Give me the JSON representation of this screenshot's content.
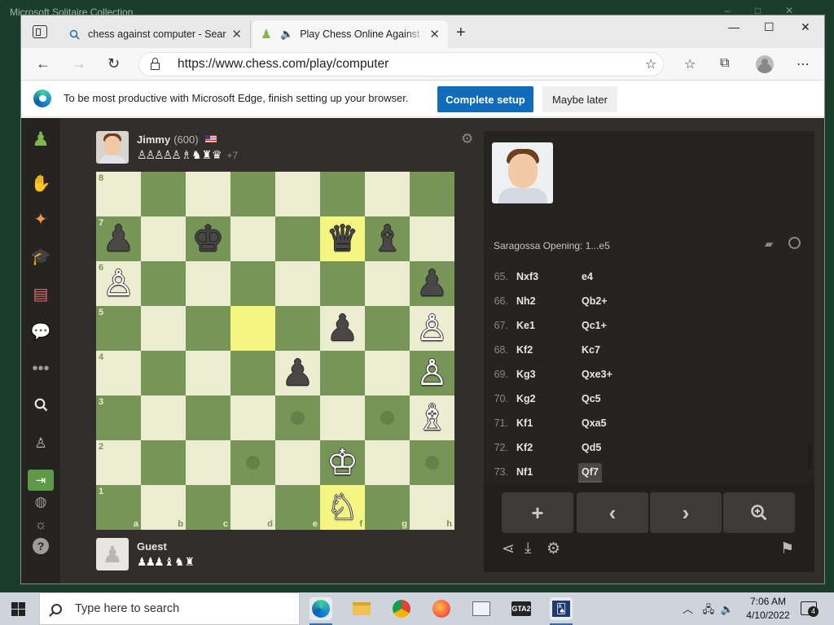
{
  "background_window": {
    "title": "Microsoft Solitaire Collection"
  },
  "browser": {
    "tabs": [
      {
        "label": "chess against computer - Search",
        "favicon": "search-icon"
      },
      {
        "label": "Play Chess Online Against the",
        "favicon": "chess-pawn-icon"
      }
    ],
    "url": "https://www.chess.com/play/computer",
    "infobar": {
      "text": "To be most productive with Microsoft Edge, finish setting up your browser.",
      "primary_button": "Complete setup",
      "secondary_button": "Maybe later"
    }
  },
  "game": {
    "top_player": {
      "name": "Jimmy",
      "rating": "(600)",
      "captured": "♙♙♙♙♙ ♗ ♞ ♜ ♛",
      "advantage": "+7"
    },
    "bottom_player": {
      "name": "Guest",
      "captured": "♟♟♟ ♝ ♞ ♜"
    },
    "board": {
      "rank_labels": [
        "8",
        "7",
        "6",
        "5",
        "4",
        "3",
        "2",
        "1"
      ],
      "file_labels": [
        "a",
        "b",
        "c",
        "d",
        "e",
        "f",
        "g",
        "h"
      ],
      "highlighted_squares": [
        "d5",
        "f7",
        "f1"
      ],
      "move_hints": [
        "e3",
        "g3",
        "d2",
        "h2"
      ],
      "pieces": [
        {
          "square": "a7",
          "glyph": "♟",
          "color": "b",
          "name": "black-pawn"
        },
        {
          "square": "c7",
          "glyph": "♚",
          "color": "b",
          "name": "black-king"
        },
        {
          "square": "f7",
          "glyph": "♛",
          "color": "b",
          "name": "black-queen"
        },
        {
          "square": "g7",
          "glyph": "♝",
          "color": "b",
          "name": "black-bishop"
        },
        {
          "square": "a6",
          "glyph": "♙",
          "color": "w",
          "name": "white-pawn"
        },
        {
          "square": "h6",
          "glyph": "♟",
          "color": "b",
          "name": "black-pawn"
        },
        {
          "square": "f5",
          "glyph": "♟",
          "color": "b",
          "name": "black-pawn"
        },
        {
          "square": "h5",
          "glyph": "♙",
          "color": "w",
          "name": "white-pawn"
        },
        {
          "square": "e4",
          "glyph": "♟",
          "color": "b",
          "name": "black-pawn"
        },
        {
          "square": "h4",
          "glyph": "♙",
          "color": "w",
          "name": "white-pawn"
        },
        {
          "square": "h3",
          "glyph": "♗",
          "color": "w",
          "name": "white-bishop"
        },
        {
          "square": "f2",
          "glyph": "♔",
          "color": "w",
          "name": "white-king"
        },
        {
          "square": "f1",
          "glyph": "♘",
          "color": "w",
          "name": "white-knight"
        }
      ]
    },
    "opening": "Saragossa Opening: 1...e5",
    "moves": [
      {
        "num": "65.",
        "white": "Nxf3",
        "black": "e4"
      },
      {
        "num": "66.",
        "white": "Nh2",
        "black": "Qb2+"
      },
      {
        "num": "67.",
        "white": "Ke1",
        "black": "Qc1+"
      },
      {
        "num": "68.",
        "white": "Kf2",
        "black": "Kc7"
      },
      {
        "num": "69.",
        "white": "Kg3",
        "black": "Qxe3+"
      },
      {
        "num": "70.",
        "white": "Kg2",
        "black": "Qc5"
      },
      {
        "num": "71.",
        "white": "Kf1",
        "black": "Qxa5"
      },
      {
        "num": "72.",
        "white": "Kf2",
        "black": "Qd5"
      },
      {
        "num": "73.",
        "white": "Nf1",
        "black": "Qf7"
      }
    ],
    "active_move_index": 8,
    "controls": [
      "+",
      "‹",
      "›",
      "⚲"
    ]
  },
  "taskbar": {
    "search_placeholder": "Type here to search",
    "time": "7:06 AM",
    "date": "4/10/2022",
    "notification_count": "4"
  },
  "colors": {
    "board_light": "#ebecd0",
    "board_dark": "#779556",
    "highlight_light": "#f5f682",
    "highlight_dark": "#b9ca43",
    "accent_blue": "#0f6cbd",
    "page_bg": "#312e2b"
  }
}
